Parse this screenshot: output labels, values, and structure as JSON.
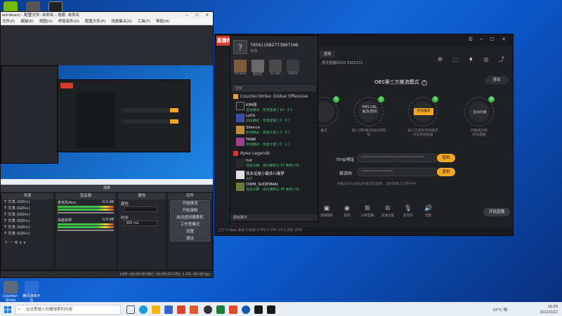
{
  "desktop": {
    "icons": [
      {
        "label": "",
        "color": "#76b900"
      },
      {
        "label": "",
        "color": "#555555"
      },
      {
        "label": "",
        "color": "#222222"
      }
    ],
    "bottom_icons": [
      {
        "label": "Counter-Strike Global",
        "color": "#5a6b7d"
      },
      {
        "label": "腾讯游戏平台",
        "color": "#2a6cd8"
      }
    ]
  },
  "obs": {
    "title": "windows) - 配置文件: 未命名 - 场景: 未命名",
    "menu": [
      "文件(F)",
      "编辑(E)",
      "视图(V)",
      "停靠部件(D)",
      "配置文件(P)",
      "场景集合(S)",
      "工具(T)",
      "帮助(H)"
    ],
    "scene_label": "场景",
    "sources_label": "来源",
    "mixer_label": "混音器",
    "properties_label": "属性",
    "controls_label": "控件",
    "sources": [
      "文本 (GDI+)",
      "文本 (GDI+)",
      "文本 (GDI+)",
      "文本 (GDI+)",
      "文本 (GDI+)",
      "文本 (GDI+)"
    ],
    "mixer": [
      {
        "name": "麦克风/Aux",
        "db": "0.0 dB"
      },
      {
        "name": "桌面音频",
        "db": "0.0 dB"
      }
    ],
    "props": [
      {
        "label": "颜色",
        "value": ""
      },
      {
        "label": "时长",
        "value": "300 ms"
      }
    ],
    "controls": [
      "开始推流",
      "开始录制",
      "启动虚拟摄像机",
      "工作室模式",
      "设置",
      "退出"
    ],
    "status": "LIVE: 00:00:00   REC: 00:00:00   CPU: 1.0%, 60.00 fps"
  },
  "gamelist": {
    "user_id": "765611982773867166",
    "user_sub": "在线",
    "friends": [
      "Tuneco",
      "爱吃虾",
      "Su fan",
      "76501"
    ],
    "search_placeholder": "搜索",
    "categories": [
      {
        "name": "Counter-Strike: Global Offensive",
        "color": "#e0a23a",
        "players": [
          {
            "name": "KIM丽",
            "status": "竞技模式 - 荒漠迷城 [ 14 : 9 ]"
          },
          {
            "name": "LoCk",
            "status": "竞技模式 - 荒漠迷城 [ 3 : 4 ]"
          },
          {
            "name": "Silence",
            "status": "休闲模式 - 炼金大厦 [ 3 : 6 ]"
          },
          {
            "name": "TANK",
            "status": "休闲模式 - 炼金大厦 [ 0 : 2 ]"
          }
        ]
      },
      {
        "name": "Apex Legends",
        "color": "#d53a2e",
        "players": [
          {
            "name": "hot",
            "status": "竞技比赛 - 排位赛积分 67 剩余小队"
          },
          {
            "name": "我永远是小霸多川离梦",
            "status": "大厅"
          },
          {
            "name": "OWM_SUDEMAN",
            "status": "竞技比赛 - 排位赛积分 85 剩余小队"
          }
        ]
      }
    ],
    "footer": "超级聊天"
  },
  "app": {
    "logo": "直播伴",
    "tab": "直播",
    "info": "虎牙直播间252   6925231",
    "heading": "OBS第三方推流模式",
    "help": "?",
    "exit": "退出",
    "steps": [
      {
        "label": "",
        "caption": "推流",
        "num": "1",
        "highlight": false
      },
      {
        "label": "FMS URL\n推流/密码",
        "caption": "填入OBS推流地址和密码",
        "num": "2",
        "highlight": false
      },
      {
        "label": "开始推流",
        "caption": "第三方软件开始推流\n点击开始直播",
        "num": "3",
        "highlight": true
      },
      {
        "label": "自动开播",
        "caption": "开播成功后\n开始直播",
        "num": "4",
        "highlight": false
      }
    ],
    "rtmp_label": "rtmp地址",
    "rtmp_value": "************************************",
    "key_label": "推流码",
    "key_value": "******************",
    "copy": "复制",
    "note": "将推流rtmp地址和推流码复制，复制到第三方软件中",
    "start": "开始直播",
    "tools": [
      "视频模板",
      "美颜",
      "分屏直播",
      "高清设置",
      "麦克风",
      "音量"
    ],
    "status": "上行 0 kbps   丢帧 0   码率 0   FPS 0   CPU 21%   内存 20%"
  },
  "taskbar": {
    "search_placeholder": "在这里输入你要搜索的内容",
    "apps": [
      "#1d7fe0",
      "#1c9bd8",
      "#f5b400",
      "#3366cc",
      "#d8452a",
      "#e0592a",
      "#333333",
      "#1a7f3c",
      "#e34a2a",
      "#0c5ab4",
      "#1a1a1a",
      "#1a1a1a"
    ],
    "weather": "10°C 晴",
    "time": "16:29",
    "date": "2022/3/22"
  }
}
